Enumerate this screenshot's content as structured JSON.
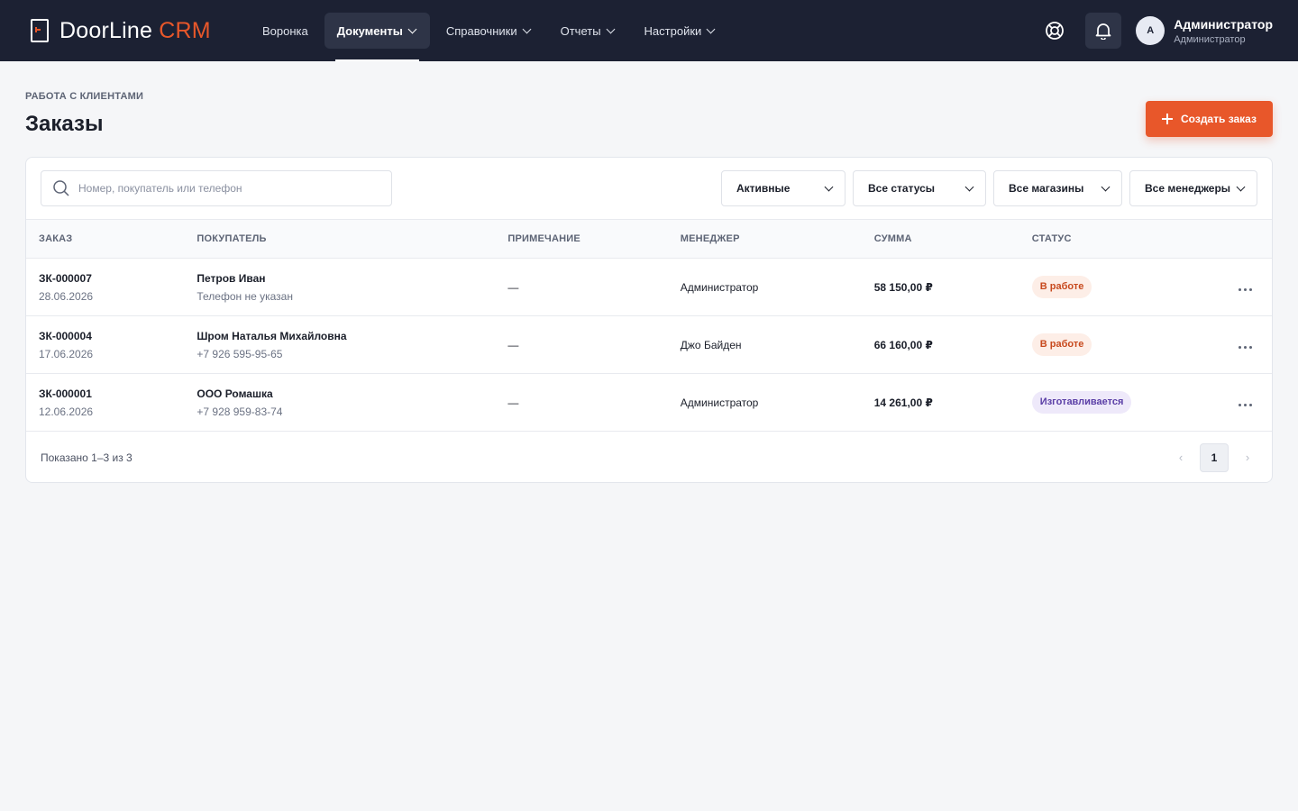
{
  "brand": {
    "name": "DoorLine",
    "suffix": "CRM"
  },
  "nav": {
    "items": [
      {
        "label": "Воронка",
        "dropdown": false,
        "active": false
      },
      {
        "label": "Документы",
        "dropdown": true,
        "active": true
      },
      {
        "label": "Справочники",
        "dropdown": true,
        "active": false
      },
      {
        "label": "Отчеты",
        "dropdown": true,
        "active": false
      },
      {
        "label": "Настройки",
        "dropdown": true,
        "active": false
      }
    ]
  },
  "user": {
    "initial": "А",
    "name": "Администратор",
    "role": "Администратор"
  },
  "page": {
    "breadcrumb": "РАБОТА С КЛИЕНТАМИ",
    "title": "Заказы",
    "create_label": "Создать заказ"
  },
  "filters": {
    "search_placeholder": "Номер, покупатель или телефон",
    "activity": "Активные",
    "status": "Все статусы",
    "store": "Все магазины",
    "manager": "Все менеджеры"
  },
  "table": {
    "headers": [
      "ЗАКАЗ",
      "ПОКУПАТЕЛЬ",
      "ПРИМЕЧАНИЕ",
      "МЕНЕДЖЕР",
      "СУММА",
      "СТАТУС"
    ],
    "rows": [
      {
        "number": "ЗК-000007",
        "date": "28.06.2026",
        "customer": "Петров Иван",
        "phone": "Телефон не указан",
        "note": "—",
        "manager": "Администратор",
        "amount": "58 150,00 ₽",
        "status": "В работе"
      },
      {
        "number": "ЗК-000004",
        "date": "17.06.2026",
        "customer": "Шром Наталья Михайловна",
        "phone": "+7 926 595-95-65",
        "note": "—",
        "manager": "Джо Байден",
        "amount": "66 160,00 ₽",
        "status": "В работе"
      },
      {
        "number": "ЗК-000001",
        "date": "12.06.2026",
        "customer": "ООО Ромашка",
        "phone": "+7 928 959-83-74",
        "note": "—",
        "manager": "Администратор",
        "amount": "14 261,00 ₽",
        "status": "Изготавливается"
      }
    ]
  },
  "footer": {
    "shown": "Показано 1–3 из 3",
    "page": "1",
    "prev": "‹",
    "next": "›"
  },
  "colors": {
    "topbar": "#1c2133",
    "accent": "#e8572a",
    "badge_work": "#fdeee7",
    "badge_make": "#eee9fa"
  }
}
